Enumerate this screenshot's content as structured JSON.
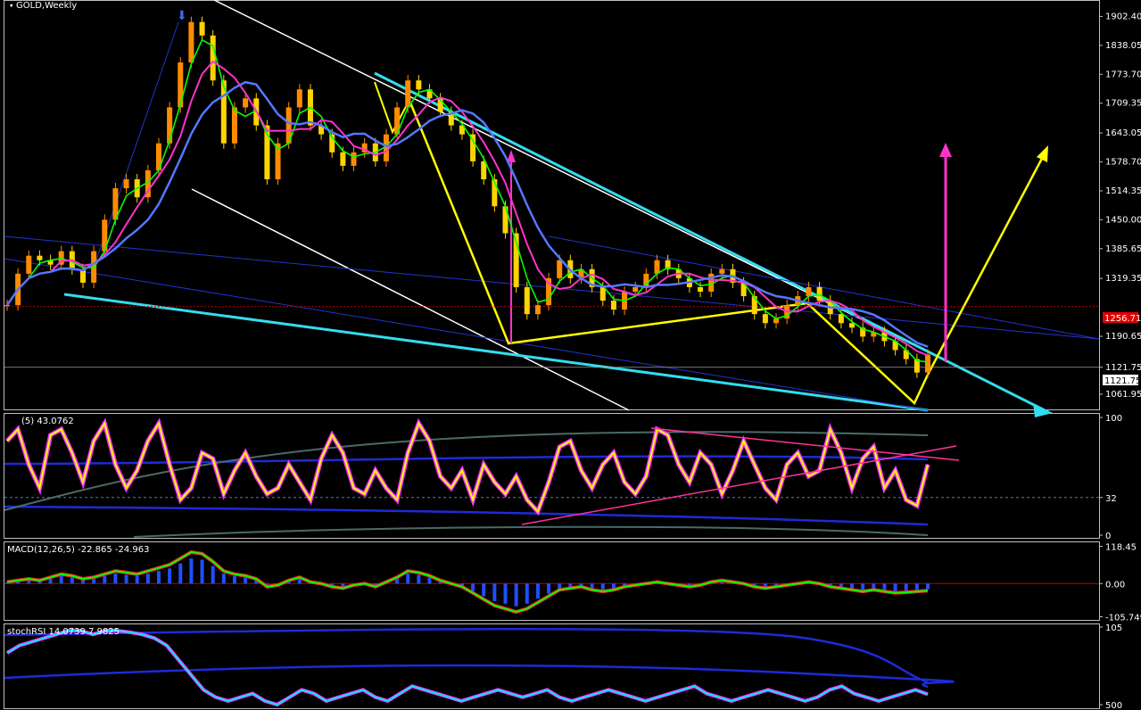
{
  "chart_data": [
    {
      "type": "candlestick",
      "title": "GOLD,Weekly",
      "y_ticks": [
        "1902.40",
        "1838.05",
        "1773.70",
        "1709.35",
        "1643.05",
        "1578.70",
        "1514.35",
        "1450.00",
        "1385.65",
        "1319.35",
        "1190.65",
        "1121.75",
        "1061.95"
      ],
      "y_tick_values": [
        1902.4,
        1838.05,
        1773.7,
        1709.35,
        1643.05,
        1578.7,
        1514.35,
        1450.0,
        1385.65,
        1319.35,
        1190.65,
        1121.75,
        1061.95
      ],
      "ylim": [
        1030,
        1935
      ],
      "current_price": "1121.75",
      "reference_price": "1256.71",
      "reference_value": 1256.71,
      "series": [
        {
          "name": "close",
          "color": "#ff8c00",
          "values": [
            1260,
            1330,
            1370,
            1360,
            1350,
            1380,
            1340,
            1310,
            1380,
            1450,
            1520,
            1540,
            1500,
            1560,
            1620,
            1700,
            1800,
            1890,
            1860,
            1760,
            1620,
            1700,
            1720,
            1660,
            1540,
            1620,
            1700,
            1740,
            1660,
            1640,
            1600,
            1570,
            1600,
            1620,
            1580,
            1640,
            1700,
            1760,
            1740,
            1720,
            1690,
            1660,
            1640,
            1580,
            1540,
            1480,
            1420,
            1300,
            1240,
            1260,
            1320,
            1360,
            1320,
            1340,
            1300,
            1270,
            1250,
            1290,
            1300,
            1330,
            1360,
            1340,
            1320,
            1300,
            1290,
            1330,
            1340,
            1310,
            1280,
            1240,
            1220,
            1230,
            1260,
            1280,
            1300,
            1270,
            1240,
            1220,
            1210,
            1190,
            1200,
            1180,
            1160,
            1140,
            1110,
            1150
          ]
        }
      ]
    },
    {
      "type": "line",
      "title": "(5) 43.0762",
      "y_ticks": [
        "100",
        "32",
        "0"
      ],
      "y_tick_values": [
        100,
        32,
        0
      ],
      "ylim": [
        0,
        100
      ],
      "series": [
        {
          "name": "",
          "color": "#ffff00",
          "values": [
            80,
            90,
            60,
            40,
            85,
            90,
            70,
            45,
            80,
            95,
            60,
            40,
            55,
            80,
            95,
            60,
            30,
            40,
            70,
            65,
            35,
            55,
            70,
            50,
            35,
            40,
            60,
            45,
            30,
            65,
            85,
            70,
            40,
            35,
            55,
            40,
            30,
            70,
            95,
            80,
            50,
            40,
            55,
            30,
            60,
            45,
            35,
            50,
            30,
            20,
            45,
            75,
            80,
            55,
            40,
            60,
            70,
            45,
            35,
            50,
            90,
            85,
            60,
            45,
            70,
            60,
            35,
            55,
            80,
            60,
            40,
            30,
            60,
            70,
            50,
            55,
            90,
            70,
            40,
            65,
            75,
            40,
            55,
            30,
            25,
            60
          ]
        }
      ]
    },
    {
      "type": "line",
      "title": "MACD(12,26,5) -22.865 -24.963",
      "y_ticks": [
        "118.45",
        "0.00",
        "-105.749"
      ],
      "y_tick_values": [
        118.45,
        0,
        -105.749
      ],
      "ylim": [
        -110,
        120
      ],
      "series": [
        {
          "name": "",
          "color": "#00ff00",
          "values": [
            5,
            10,
            15,
            10,
            20,
            30,
            25,
            15,
            20,
            30,
            40,
            35,
            30,
            40,
            50,
            60,
            80,
            100,
            95,
            70,
            40,
            30,
            25,
            15,
            -10,
            -5,
            10,
            20,
            5,
            0,
            -10,
            -15,
            -5,
            0,
            -10,
            5,
            20,
            40,
            35,
            25,
            10,
            0,
            -10,
            -30,
            -50,
            -70,
            -80,
            -90,
            -80,
            -60,
            -40,
            -20,
            -15,
            -10,
            -20,
            -25,
            -20,
            -10,
            -5,
            0,
            5,
            0,
            -5,
            -10,
            -5,
            5,
            10,
            5,
            0,
            -10,
            -15,
            -10,
            -5,
            0,
            5,
            0,
            -10,
            -15,
            -20,
            -25,
            -20,
            -25,
            -30,
            -28,
            -25,
            -22.865
          ]
        }
      ]
    },
    {
      "type": "line",
      "title": "stochRSI 14.0739 7.9825",
      "y_ticks": [
        "105",
        "500"
      ],
      "y_tick_values": [
        105,
        0
      ],
      "ylim": [
        0,
        105
      ],
      "series": [
        {
          "name": "",
          "color": "#00e5ff",
          "values": [
            70,
            80,
            85,
            90,
            95,
            100,
            100,
            95,
            100,
            100,
            98,
            95,
            90,
            80,
            60,
            40,
            20,
            10,
            5,
            10,
            15,
            5,
            0,
            10,
            20,
            15,
            5,
            10,
            15,
            20,
            10,
            5,
            15,
            25,
            20,
            15,
            10,
            5,
            10,
            15,
            20,
            15,
            10,
            15,
            20,
            10,
            5,
            10,
            15,
            20,
            15,
            10,
            5,
            10,
            15,
            20,
            25,
            15,
            10,
            5,
            10,
            15,
            20,
            15,
            10,
            5,
            10,
            20,
            25,
            15,
            10,
            5,
            10,
            15,
            20,
            14
          ]
        }
      ]
    }
  ]
}
